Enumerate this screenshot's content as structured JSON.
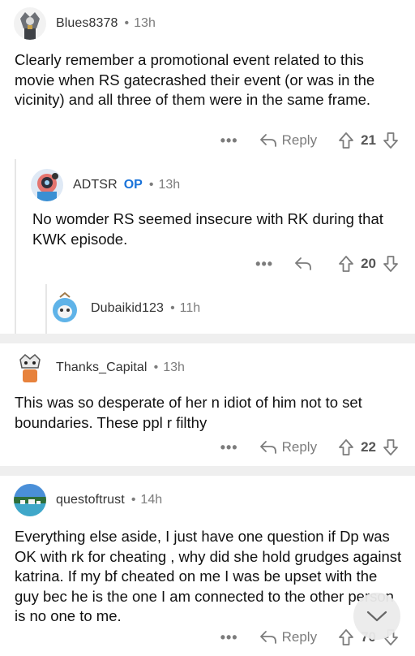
{
  "comments": [
    {
      "username": "Blues8378",
      "time": "13h",
      "text": "Clearly remember a promotional event related to this movie when RS gatecrashed their event (or was in the vicinity) and all three of them were in the same frame.",
      "reply_label": "Reply",
      "votes": "21"
    },
    {
      "username": "ADTSR",
      "op_badge": "OP",
      "time": "13h",
      "text": "No womder RS seemed insecure with RK during that KWK episode.",
      "votes": "20"
    },
    {
      "username": "Dubaikid123",
      "time": "11h"
    },
    {
      "username": "Thanks_Capital",
      "time": "13h",
      "text": "This was so desperate of her n idiot of him not to set boundaries. These ppl r filthy",
      "reply_label": "Reply",
      "votes": "22"
    },
    {
      "username": "questoftrust",
      "time": "14h",
      "text": "Everything else aside, I just have one question if Dp was OK with rk for cheating , why did she hold grudges against katrina. If my bf cheated on me I was be upset with the guy bec he is the one I am connected to the other person is no one to me.",
      "reply_label": "Reply",
      "votes": "70"
    }
  ],
  "separator_dot": "•",
  "more_label": "•••",
  "colors": {
    "op_blue": "#1a73d9",
    "meta_gray": "#7c7c7c",
    "separator": "#efefef"
  },
  "icons": [
    "reply-arrow-icon",
    "upvote-arrow-icon",
    "downvote-arrow-icon",
    "chevron-down-icon"
  ]
}
